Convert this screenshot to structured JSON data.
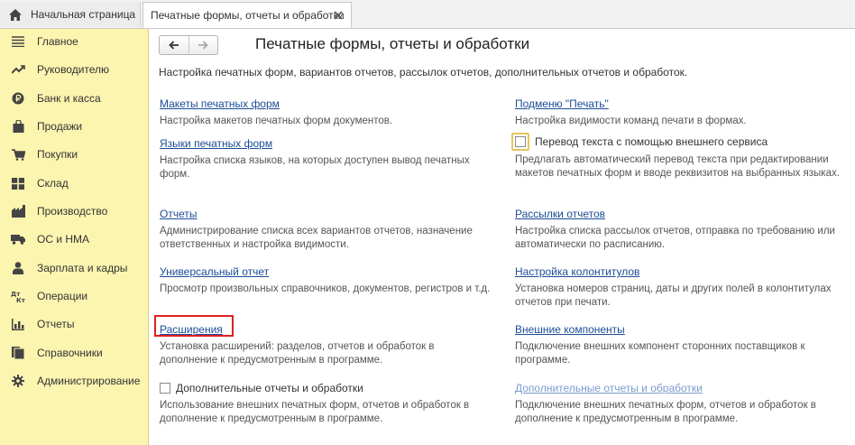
{
  "tabs": {
    "home_label": "Начальная страница",
    "active_label": "Печатные формы, отчеты и обработки"
  },
  "sidebar": {
    "items": [
      {
        "label": "Главное",
        "icon": "menu-lines-icon"
      },
      {
        "label": "Руководителю",
        "icon": "trend-chart-icon"
      },
      {
        "label": "Банк и касса",
        "icon": "ruble-coin-icon"
      },
      {
        "label": "Продажи",
        "icon": "bag-icon"
      },
      {
        "label": "Покупки",
        "icon": "cart-icon"
      },
      {
        "label": "Склад",
        "icon": "grid-icon"
      },
      {
        "label": "Производство",
        "icon": "factory-icon"
      },
      {
        "label": "ОС и НМА",
        "icon": "truck-icon"
      },
      {
        "label": "Зарплата и кадры",
        "icon": "person-icon"
      },
      {
        "label": "Операции",
        "icon": "dt-kt-icon"
      },
      {
        "label": "Отчеты",
        "icon": "bar-chart-icon"
      },
      {
        "label": "Справочники",
        "icon": "books-icon"
      },
      {
        "label": "Администрирование",
        "icon": "gear-icon"
      }
    ]
  },
  "page": {
    "title": "Печатные формы, отчеты и обработки",
    "subtitle": "Настройка печатных форм, вариантов отчетов, рассылок отчетов, дополнительных отчетов и обработок."
  },
  "left": {
    "makety": {
      "link": "Макеты печатных форм",
      "desc": "Настройка макетов печатных форм документов."
    },
    "yazyki": {
      "link": "Языки печатных форм",
      "desc": "Настройка списка языков, на которых доступен вывод печатных форм."
    },
    "otchety": {
      "link": "Отчеты",
      "desc": "Администрирование списка всех вариантов отчетов, назначение ответственных и настройка видимости."
    },
    "universal": {
      "link": "Универсальный отчет",
      "desc": "Просмотр произвольных справочников, документов, регистров и т.д."
    },
    "rasshireniya": {
      "link": "Расширения",
      "desc": "Установка расширений: разделов, отчетов и обработок в дополнение к предусмотренным в программе."
    },
    "dop": {
      "checkbox": "Дополнительные отчеты и обработки",
      "desc": "Использование внешних печатных форм, отчетов и обработок в дополнение к предусмотренным в программе."
    }
  },
  "right": {
    "podmenu": {
      "link": "Подменю \"Печать\"",
      "desc": "Настройка видимости команд печати в формах."
    },
    "perevod": {
      "checkbox": "Перевод текста с помощью внешнего сервиса",
      "desc": "Предлагать автоматический перевод текста при редактировании макетов печатных форм и вводе реквизитов на выбранных языках."
    },
    "rassylki": {
      "link": "Рассылки отчетов",
      "desc": "Настройка списка рассылок отчетов, отправка по требованию или автоматически по расписанию."
    },
    "kolontituly": {
      "link": "Настройка колонтитулов",
      "desc": "Установка номеров страниц, даты и других полей в колонтитулах отчетов при печати."
    },
    "vneshnie": {
      "link": "Внешние компоненты",
      "desc": "Подключение внешних компонент сторонних поставщиков к программе."
    },
    "dop_link": {
      "link": "Дополнительные отчеты и обработки",
      "desc": "Подключение внешних печатных форм, отчетов и обработок в дополнение к предусмотренным в программе."
    }
  }
}
